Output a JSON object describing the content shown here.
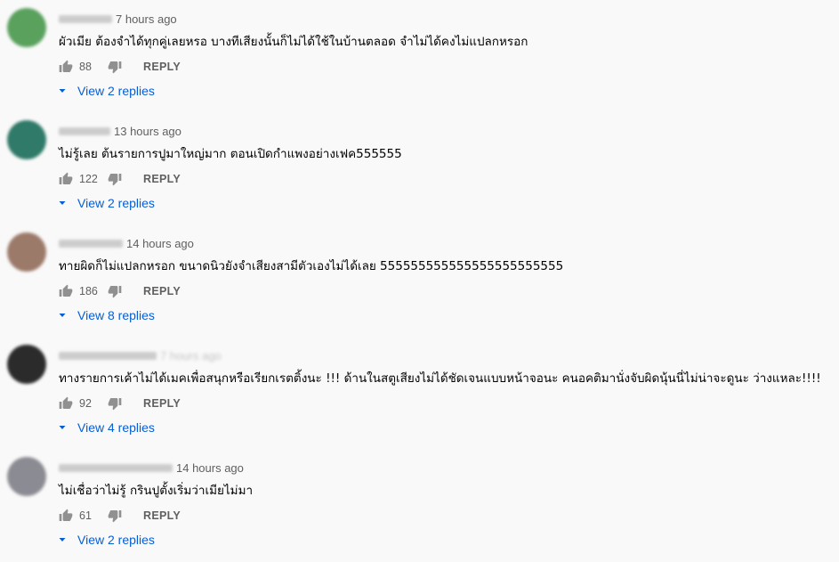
{
  "colors": {
    "background": "#f9f9f9",
    "text": "#030303",
    "secondary": "#606060",
    "link": "#065fd4"
  },
  "reply_label": "REPLY",
  "comments": [
    {
      "avatar_color": "#5aa15e",
      "time": "7 hours ago",
      "text": "ผัวเมีย ต้องจำได้ทุกคู่เลยหรอ บางทีเสียงนั้นก็ไม่ได้ใช้ในบ้านตลอด จำไม่ได้คงไม่แปลกหรอก",
      "likes": "88",
      "replies_label": "View 2 replies"
    },
    {
      "avatar_color": "#2f7a69",
      "time": "13 hours ago",
      "text": "ไม่รู้เลย ต้นรายการปูมาใหญ่มาก ตอนเปิดกำแพงอย่างเฟค555555",
      "likes": "122",
      "replies_label": "View 2 replies"
    },
    {
      "avatar_color": "#9c7a6a",
      "time": "14 hours ago",
      "text": "ทายผิดก็ไม่แปลกหรอก ขนาดนิวยังจำเสียงสามีตัวเองไม่ได้เลย 555555555555555555555555",
      "likes": "186",
      "replies_label": "View 8 replies"
    },
    {
      "avatar_color": "#2b2b2b",
      "time": "7 hours ago",
      "time_blurred": true,
      "text": "ทางรายการเค้าไม่ได้เมคเพื่อสนุกหรือเรียกเรตติ้งนะ !!! ด้านในสตูเสียงไม่ได้ชัดเจนแบบหน้าจอนะ คนอคติมานั่งจับผิดนุ้นนี่ไม่น่าจะดูนะ  ว่างแหละ!!!!",
      "likes": "92",
      "replies_label": "View 4 replies"
    },
    {
      "avatar_color": "#8b8b93",
      "time": "14 hours ago",
      "text": "ไม่เชื่อว่าไม่รู้ กรินปูตั้งเริ่มว่าเมียไม่มา",
      "likes": "61",
      "replies_label": "View 2 replies"
    }
  ]
}
